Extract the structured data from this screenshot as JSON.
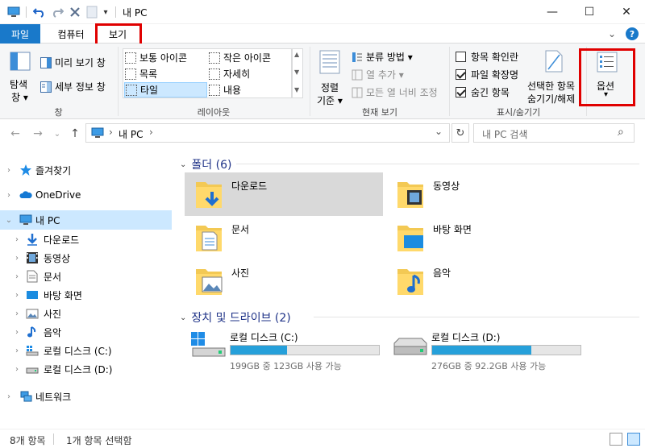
{
  "titlebar": {
    "title": "내 PC",
    "qa_dropdown": "▾",
    "minimize": "—",
    "maximize": "☐",
    "close": "✕"
  },
  "tabs": {
    "file": "파일",
    "computer": "컴퓨터",
    "view": "보기",
    "expand_icon": "⌄",
    "help_icon": "?"
  },
  "ribbon": {
    "pane": {
      "nav_pane": "탐색\n창",
      "nav_pane_line1": "탐색",
      "nav_pane_line2": "창 ▾",
      "preview": "미리 보기 창",
      "details": "세부 정보 창",
      "label": "창"
    },
    "layout": {
      "items": [
        "보통 아이콘",
        "작은 아이콘",
        "목록",
        "자세히",
        "타일",
        "내용"
      ],
      "label": "레이아웃"
    },
    "current_view": {
      "sort_line1": "정렬",
      "sort_line2": "기준 ▾",
      "group_by": "분류 방법 ▾",
      "add_column": "열 추가 ▾",
      "fit_columns": "모든 열 너비 조정",
      "label": "현재 보기"
    },
    "show_hide": {
      "item_checkboxes": "항목 확인란",
      "item_checkboxes_checked": false,
      "file_extensions": "파일 확장명",
      "file_extensions_checked": true,
      "hidden_items": "숨긴 항목",
      "hidden_items_checked": true,
      "hide_selected_line1": "선택한 항목",
      "hide_selected_line2": "숨기기/해제",
      "label": "표시/숨기기"
    },
    "options": {
      "label": "옵션",
      "arrow": "▾"
    }
  },
  "address": {
    "path_root": "내 PC",
    "sep": "›",
    "dropdown": "⌄",
    "refresh": "↻",
    "search_placeholder": "내 PC 검색",
    "search_icon": "⌕"
  },
  "nav": {
    "items": [
      {
        "label": "즐겨찾기"
      },
      {
        "label": "OneDrive"
      },
      {
        "label": "내 PC"
      },
      {
        "label": "다운로드"
      },
      {
        "label": "동영상"
      },
      {
        "label": "문서"
      },
      {
        "label": "바탕 화면"
      },
      {
        "label": "사진"
      },
      {
        "label": "음악"
      },
      {
        "label": "로컬 디스크 (C:)"
      },
      {
        "label": "로컬 디스크 (D:)"
      },
      {
        "label": "네트워크"
      }
    ]
  },
  "content": {
    "folders_header": "폴더 (6)",
    "folders": [
      {
        "label": "다운로드"
      },
      {
        "label": "동영상"
      },
      {
        "label": "문서"
      },
      {
        "label": "바탕 화면"
      },
      {
        "label": "사진"
      },
      {
        "label": "음악"
      }
    ],
    "drives_header": "장치 및 드라이브 (2)",
    "drives": [
      {
        "name": "로컬 디스크 (C:)",
        "free": "199GB 중 123GB 사용 가능",
        "used_fraction": 0.38
      },
      {
        "name": "로컬 디스크 (D:)",
        "free": "276GB 중 92.2GB 사용 가능",
        "used_fraction": 0.67
      }
    ]
  },
  "status": {
    "count": "8개 항목",
    "selected": "1개 항목 선택함"
  },
  "colors": {
    "accent": "#1979ca",
    "highlight_red": "#e00000",
    "drive_bar": "#26a0da",
    "selection": "#cce8ff",
    "header_blue": "#1e3287"
  }
}
